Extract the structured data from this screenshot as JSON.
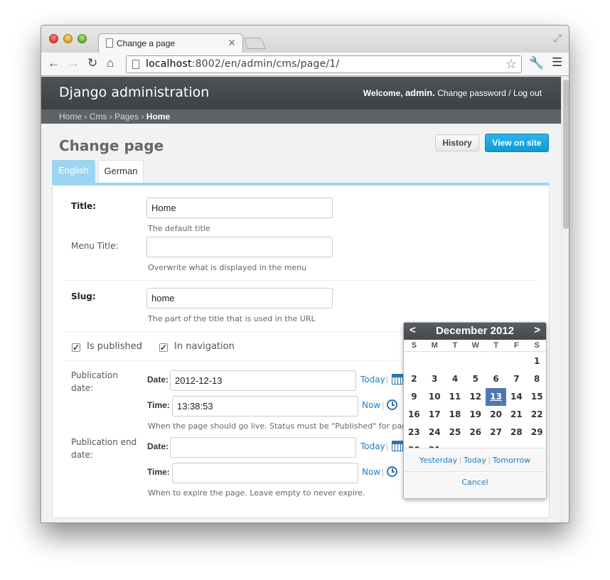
{
  "browser": {
    "tab_title": "Change a page",
    "url_host": "localhost",
    "url_rest": ":8002/en/admin/cms/page/1/"
  },
  "admin": {
    "site_name": "Django administration",
    "welcome": "Welcome,",
    "username": "admin.",
    "change_password": "Change password",
    "slash": "/",
    "log_out": "Log out"
  },
  "breadcrumbs": {
    "items": [
      "Home",
      "Cms",
      "Pages"
    ],
    "sep": "›",
    "current": "Home"
  },
  "page": {
    "title": "Change page",
    "history_button": "History",
    "view_on_site_button": "View on site"
  },
  "language_tabs": {
    "active": "English",
    "inactive": "German"
  },
  "form": {
    "title_label": "Title:",
    "title_value": "Home",
    "title_help": "The default title",
    "menu_title_label": "Menu Title:",
    "menu_title_value": "",
    "menu_title_help": "Overwrite what is displayed in the menu",
    "slug_label": "Slug:",
    "slug_value": "home",
    "slug_help": "The part of the title that is used in the URL",
    "is_published_label": "Is published",
    "is_published_checked": true,
    "in_navigation_label": "In navigation",
    "in_navigation_checked": true,
    "pub_date_label_1": "Publication",
    "pub_date_label_2": "date:",
    "date_label": "Date:",
    "time_label": "Time:",
    "pub_date_value": "2012-12-13",
    "pub_time_value": "13:38:53",
    "today_link": "Today",
    "now_link": "Now",
    "link_sep": "|",
    "pub_help": "When the page should go live. Status must be \"Published\" for page to go li",
    "pub_end_label_1": "Publication end",
    "pub_end_label_2": "date:",
    "pub_end_date_value": "",
    "pub_end_time_value": "",
    "pub_end_help": "When to expire the page. Leave empty to never expire."
  },
  "calendar": {
    "prev": "<",
    "next": ">",
    "month": "December 2012",
    "weekdays": [
      "S",
      "M",
      "T",
      "W",
      "T",
      "F",
      "S"
    ],
    "first_weekday_index": 6,
    "days_in_month": 31,
    "selected_day": 13,
    "yesterday": "Yesterday",
    "today": "Today",
    "tomorrow": "Tomorrow",
    "quick_sep": "|",
    "cancel": "Cancel"
  },
  "colors": {
    "accent_blue": "#0e9bd6",
    "tab_active": "#9bd5f2",
    "link": "#1b7fc4",
    "header": "#45494e"
  }
}
